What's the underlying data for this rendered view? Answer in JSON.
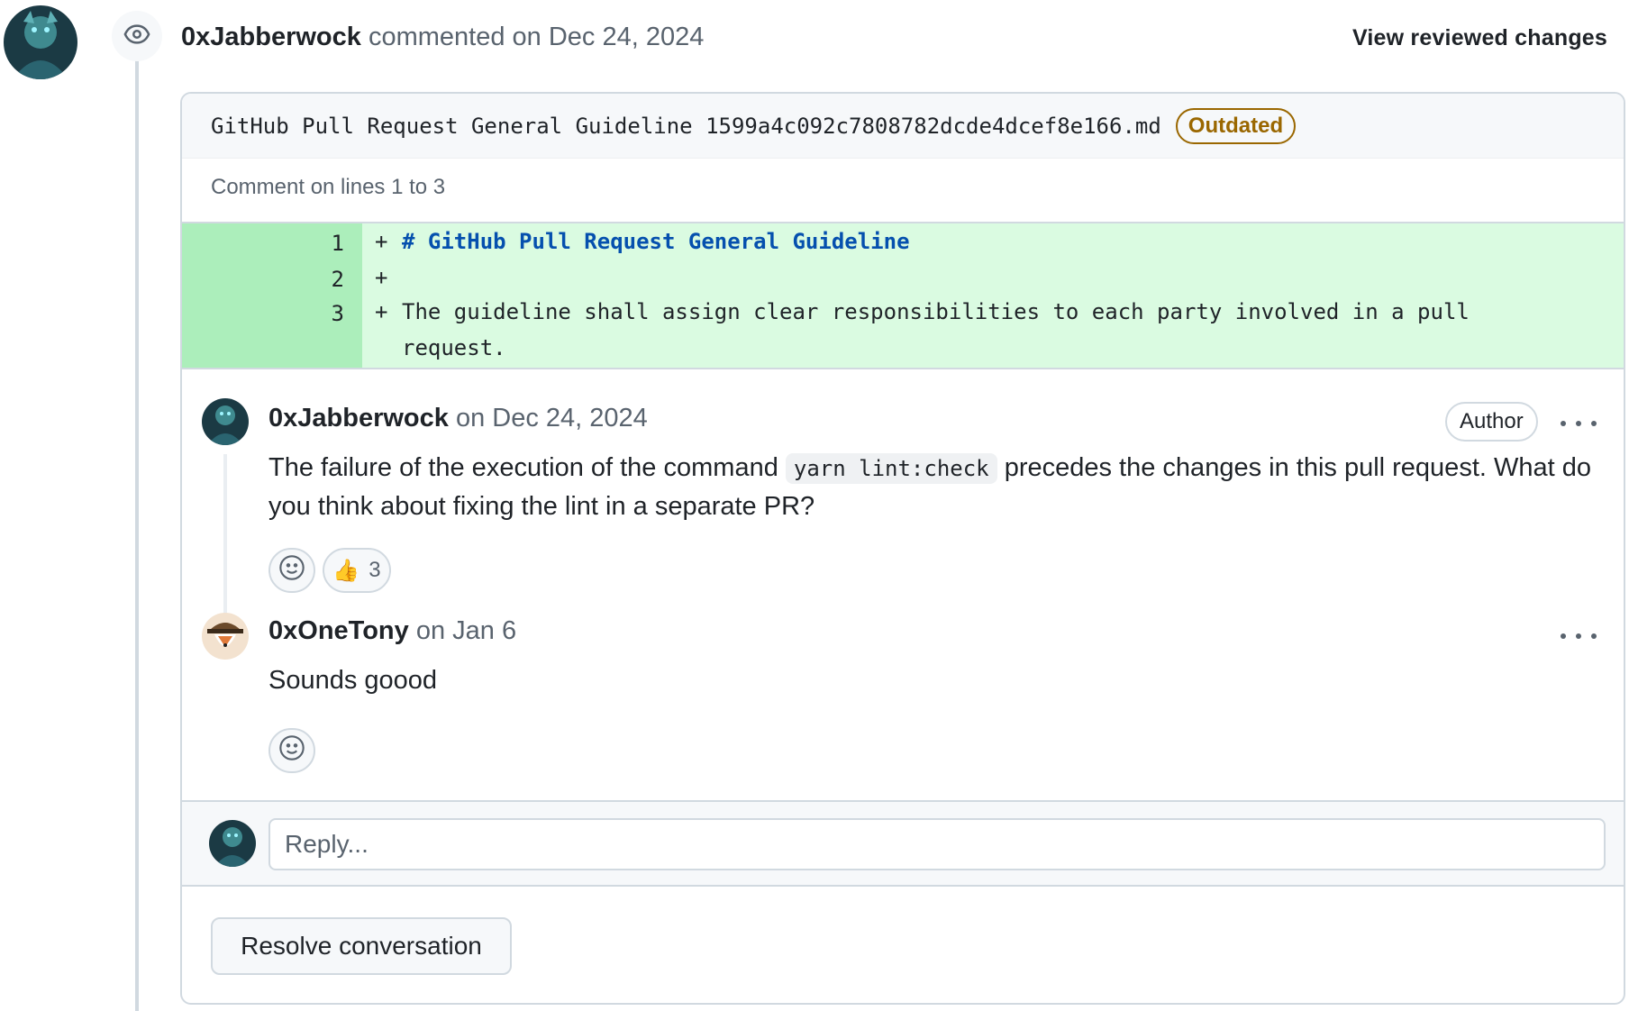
{
  "timeline": {
    "author": "0xJabberwock",
    "action": "commented",
    "date": "on Dec 24, 2024",
    "view_reviewed_label": "View reviewed changes",
    "event_icon": "eye-icon"
  },
  "file": {
    "name": "GitHub Pull Request General Guideline 1599a4c092c7808782dcde4dcef8e166.md",
    "status_badge": "Outdated",
    "comment_lines": "Comment on lines 1 to 3"
  },
  "diff": {
    "lines": [
      {
        "number": "1",
        "marker": "+",
        "text": "# GitHub Pull Request General Guideline"
      },
      {
        "number": "2",
        "marker": "+",
        "text": ""
      },
      {
        "number": "3",
        "marker": "+",
        "text": "The guideline shall assign clear responsibilities to each party involved in a pull",
        "continuation": "request."
      }
    ]
  },
  "comments": [
    {
      "author": "0xJabberwock",
      "date": "on Dec 24, 2024",
      "badge": "Author",
      "body_before": "The failure of the execution of the command",
      "code": "yarn lint:check",
      "body_after": "precedes the changes in this pull request. What do you think about fixing the lint in a separate PR?",
      "reactions": [
        {
          "emoji": "👍",
          "count": "3"
        }
      ]
    },
    {
      "author": "0xOneTony",
      "date": "on Jan 6",
      "body": "Sounds goood"
    }
  ],
  "reply": {
    "placeholder": "Reply..."
  },
  "actions": {
    "resolve_label": "Resolve conversation"
  },
  "colors": {
    "added_line_bg": "#dafbe1",
    "added_gutter_bg": "#aceebb",
    "outdated": "#9a6700",
    "heading_code": "#0550ae"
  }
}
